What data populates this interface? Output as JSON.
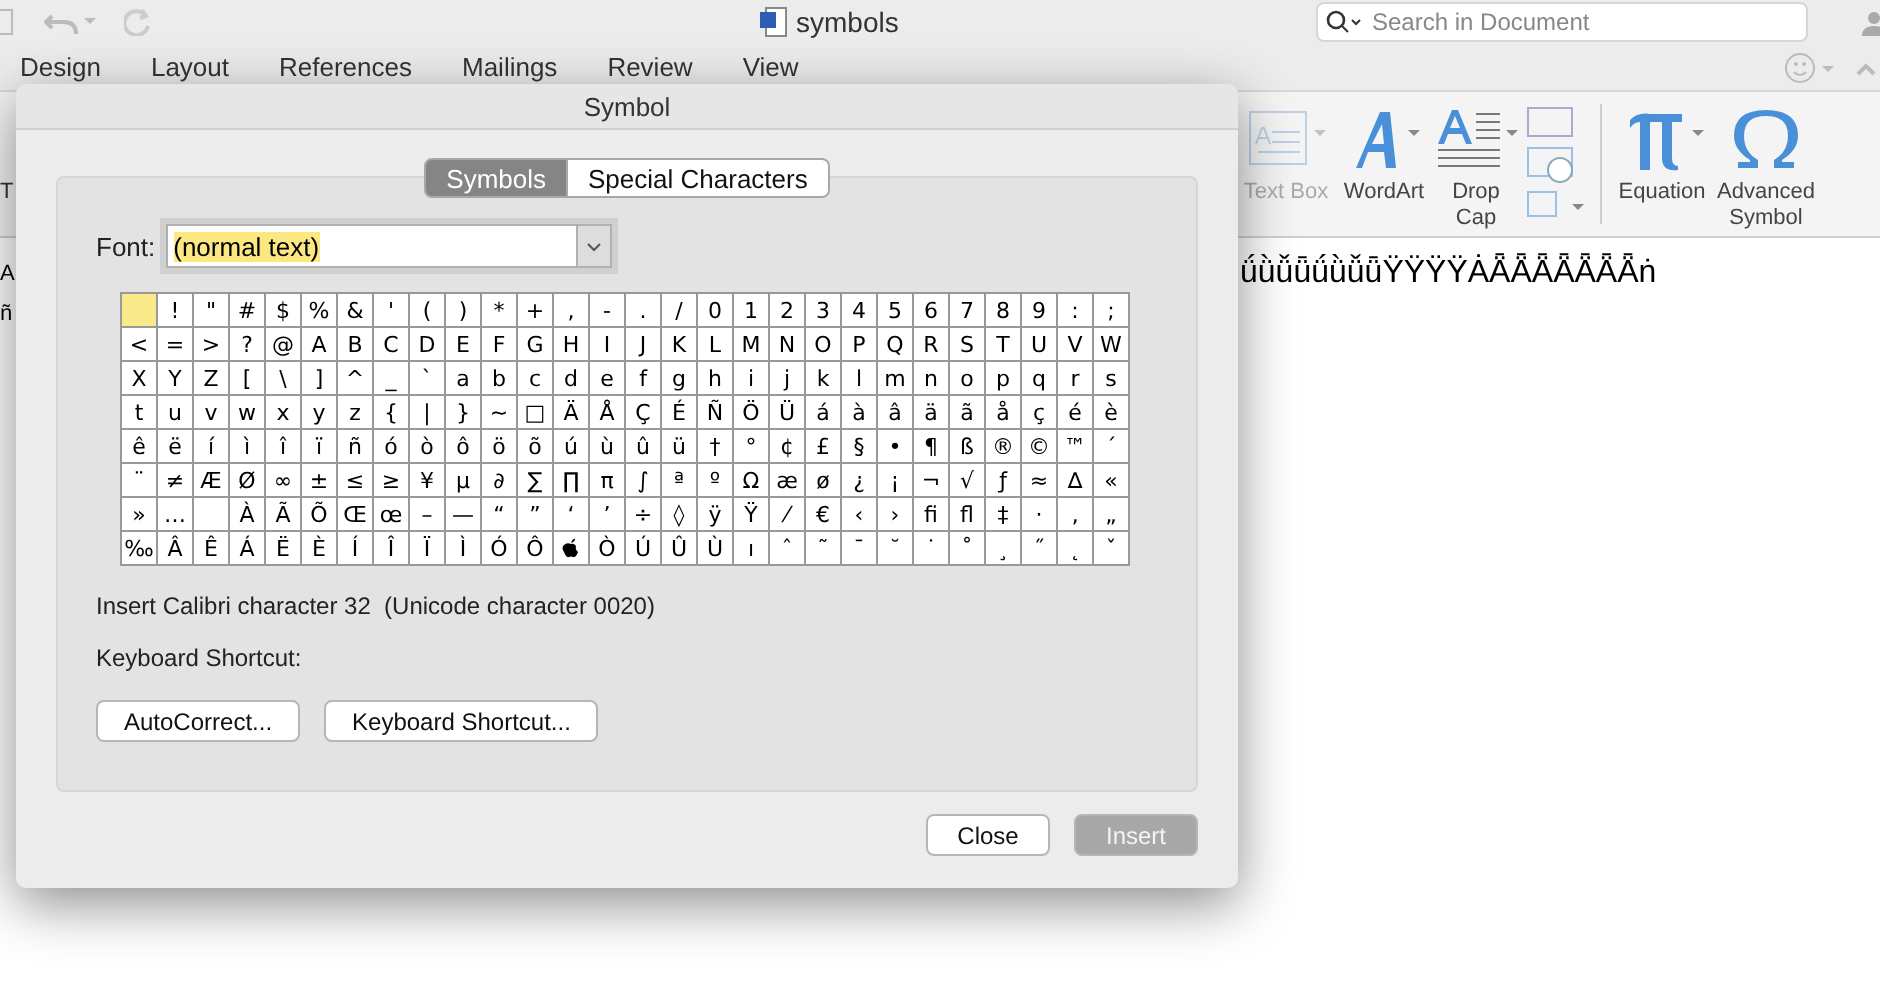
{
  "window": {
    "title": "symbols"
  },
  "search": {
    "placeholder": "Search in Document"
  },
  "ribbon_tabs": [
    "Design",
    "Layout",
    "References",
    "Mailings",
    "Review",
    "View"
  ],
  "ribbon_edge_label": "T",
  "ribbon_tools": [
    {
      "kind": "textbox",
      "label": "Text Box",
      "disabled": true
    },
    {
      "kind": "wordart",
      "label": "WordArt",
      "disabled": false
    },
    {
      "kind": "dropcap",
      "label": "Drop Cap",
      "disabled": false
    },
    {
      "kind": "small"
    },
    {
      "kind": "equation",
      "label": "Equation",
      "disabled": false
    },
    {
      "kind": "symbol",
      "label": "Advanced Symbol",
      "disabled": false
    }
  ],
  "document": {
    "lines": [
      {
        "start": "A",
        "end": "ǘǜǚǖǘǜǚǖŸŸŸŸȦǞǞǞǞǞǞǞṅ"
      },
      {
        "start": "ñ"
      }
    ]
  },
  "dialog": {
    "title": "Symbol",
    "tabs": [
      {
        "label": "Symbols",
        "selected": true
      },
      {
        "label": "Special Characters",
        "selected": false
      }
    ],
    "font": {
      "label": "Font:",
      "value": "(normal text)"
    },
    "grid": [
      [
        {
          "kind": "blank",
          "selected": true
        },
        "!",
        "\"",
        "#",
        "$",
        "%",
        "&",
        "'",
        "(",
        ")",
        "*",
        "+",
        ",",
        "-",
        ".",
        "/",
        "0",
        "1",
        "2",
        "3",
        "4",
        "5",
        "6",
        "7",
        "8",
        "9",
        ":",
        ";"
      ],
      [
        "<",
        "=",
        ">",
        "?",
        "@",
        "A",
        "B",
        "C",
        "D",
        "E",
        "F",
        "G",
        "H",
        "I",
        "J",
        "K",
        "L",
        "M",
        "N",
        "O",
        "P",
        "Q",
        "R",
        "S",
        "T",
        "U",
        "V",
        "W"
      ],
      [
        "X",
        "Y",
        "Z",
        "[",
        "\\",
        "]",
        "^",
        "_",
        "`",
        "a",
        "b",
        "c",
        "d",
        "e",
        "f",
        "g",
        "h",
        "i",
        "j",
        "k",
        "l",
        "m",
        "n",
        "o",
        "p",
        "q",
        "r",
        "s"
      ],
      [
        "t",
        "u",
        "v",
        "w",
        "x",
        "y",
        "z",
        "{",
        "|",
        "}",
        "~",
        "□",
        "Ä",
        "Å",
        "Ç",
        "É",
        "Ñ",
        "Ö",
        "Ü",
        "á",
        "à",
        "â",
        "ä",
        "ã",
        "å",
        "ç",
        "é",
        "è"
      ],
      [
        "ê",
        "ë",
        "í",
        "ì",
        "î",
        "ï",
        "ñ",
        "ó",
        "ò",
        "ô",
        "ö",
        "õ",
        "ú",
        "ù",
        "û",
        "ü",
        "†",
        "°",
        "¢",
        "£",
        "§",
        "•",
        "¶",
        "ß",
        "®",
        "©",
        "™",
        "´"
      ],
      [
        "¨",
        "≠",
        "Æ",
        "Ø",
        "∞",
        "±",
        "≤",
        "≥",
        "¥",
        "µ",
        "∂",
        "∑",
        "∏",
        "π",
        "∫",
        "ª",
        "º",
        "Ω",
        "æ",
        "ø",
        "¿",
        "¡",
        "¬",
        "√",
        "ƒ",
        "≈",
        "∆",
        "«"
      ],
      [
        "»",
        "…",
        {
          "kind": "blank",
          "selected": false
        },
        "À",
        "Ã",
        "Õ",
        "Œ",
        "œ",
        "–",
        "—",
        "“",
        "”",
        "‘",
        "’",
        "÷",
        "◊",
        "ÿ",
        "Ÿ",
        "⁄",
        "€",
        "‹",
        "›",
        "ﬁ",
        "ﬂ",
        "‡",
        "·",
        "‚",
        "„"
      ],
      [
        "‰",
        "Â",
        "Ê",
        "Á",
        "Ë",
        "È",
        "Í",
        "Î",
        "Ï",
        "Ì",
        "Ó",
        "Ô",
        {
          "kind": "apple",
          "selected": false
        },
        "Ò",
        "Ú",
        "Û",
        "Ù",
        "ı",
        "ˆ",
        "˜",
        "¯",
        "˘",
        "˙",
        "˚",
        "¸",
        "˝",
        "˛",
        "ˇ"
      ]
    ],
    "info": "Insert Calibri character 32  (Unicode character 0020)",
    "shortcut_label": "Keyboard Shortcut:",
    "buttons": [
      "AutoCorrect...",
      "Keyboard Shortcut..."
    ],
    "footer_buttons": [
      {
        "label": "Close",
        "disabled": false
      },
      {
        "label": "Insert",
        "disabled": true
      }
    ]
  }
}
